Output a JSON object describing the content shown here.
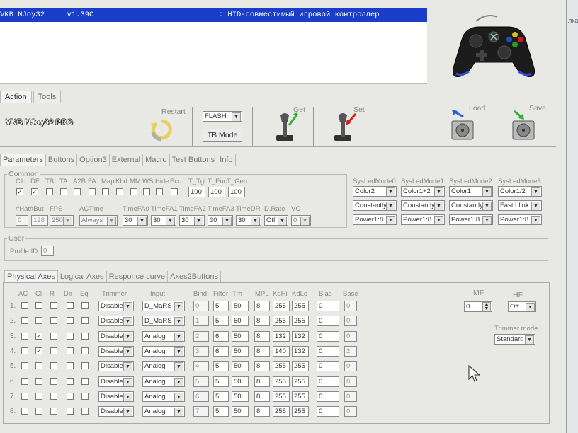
{
  "title_bar": "VKB NJoy32     v1.39C                            : HID-совместимый игровой контроллер",
  "side_strip_text": "лка",
  "top_tabs": [
    "Action",
    "Tools"
  ],
  "brand": "VKB NJoy32 PRO",
  "toolbar": {
    "restart": "Restart",
    "flash_select": "FLASH",
    "tb_mode": "TB Mode",
    "get": "Get",
    "set": "Set",
    "load": "Load",
    "save": "Save"
  },
  "param_tabs": [
    "Parameters",
    "Buttons",
    "Option3",
    "External",
    "Macro",
    "Test Buttons",
    "Info"
  ],
  "common": {
    "title": "Common",
    "checkbox_labels": [
      "Clb",
      "DF",
      "TB",
      "TA",
      "A2B",
      "FA",
      "Map",
      "Kbd",
      "MM",
      "WS",
      "Hide",
      "Eco"
    ],
    "checked": [
      true,
      true,
      false,
      false,
      false,
      false,
      false,
      false,
      false,
      false,
      false,
      false
    ],
    "t_labels": [
      "T_Tgl",
      "T_Enc",
      "T_Gen"
    ],
    "t_values": [
      "100",
      "100",
      "100"
    ],
    "row2_labels": [
      "#Hat",
      "#But",
      "FPS",
      "ACTime",
      "TimeFA0",
      "TimeFA1",
      "TimeFA2",
      "TimeFA3",
      "TimeDR",
      "D.Rate",
      "VC"
    ],
    "hat": "0",
    "but": "128",
    "fps": "250",
    "actime": "Always",
    "timefa": [
      "30",
      "30",
      "30",
      "30",
      "30"
    ],
    "drate": "Off",
    "vc": "0"
  },
  "sysled": {
    "labels": [
      "SysLedMode0",
      "SysLedMode1",
      "SysLedMode2",
      "SysLedMode3"
    ],
    "row1": [
      "Color2",
      "Color1+2",
      "Color1",
      "Color1/2"
    ],
    "row2": [
      "Constantly",
      "Constantly",
      "Constantly",
      "Fast blink"
    ],
    "row3": [
      "Power1:8",
      "Power1:8",
      "Power1:8",
      "Power1:8"
    ]
  },
  "user": {
    "title": "User",
    "profile_label": "Profile ID",
    "profile_value": "0"
  },
  "axes_tabs": [
    "Physical Axes",
    "Logical Axes",
    "Responce curve",
    "Axes2Buttons"
  ],
  "axes_headers": [
    "AC",
    "Cl",
    "R",
    "Dir",
    "Eq",
    "Trimmer",
    "Input",
    "Bind",
    "Filter",
    "Trh",
    "MPL",
    "KdHi",
    "KdLo",
    "Bias",
    "Base"
  ],
  "axes_rows": [
    {
      "n": "1.",
      "cl": false,
      "trimmer": "Disable",
      "input": "D_MaRS",
      "bind": "0",
      "filter": "5",
      "trh": "50",
      "mpl": "8",
      "kdhi": "255",
      "kdlo": "255",
      "bias": "0",
      "base": "0"
    },
    {
      "n": "2.",
      "cl": false,
      "trimmer": "Disable",
      "input": "D_MaRS",
      "bind": "1",
      "filter": "5",
      "trh": "50",
      "mpl": "8",
      "kdhi": "255",
      "kdlo": "255",
      "bias": "0",
      "base": "0"
    },
    {
      "n": "3.",
      "cl": true,
      "trimmer": "Disable",
      "input": "Analog",
      "bind": "2",
      "filter": "6",
      "trh": "50",
      "mpl": "8",
      "kdhi": "132",
      "kdlo": "132",
      "bias": "0",
      "base": "0"
    },
    {
      "n": "4.",
      "cl": true,
      "trimmer": "Disable",
      "input": "Analog",
      "bind": "3",
      "filter": "6",
      "trh": "50",
      "mpl": "8",
      "kdhi": "140",
      "kdlo": "132",
      "bias": "0",
      "base": "2"
    },
    {
      "n": "5.",
      "cl": false,
      "trimmer": "Disable",
      "input": "Analog",
      "bind": "4",
      "filter": "5",
      "trh": "50",
      "mpl": "8",
      "kdhi": "255",
      "kdlo": "255",
      "bias": "0",
      "base": "0"
    },
    {
      "n": "6.",
      "cl": false,
      "trimmer": "Disable",
      "input": "Analog",
      "bind": "5",
      "filter": "5",
      "trh": "50",
      "mpl": "8",
      "kdhi": "255",
      "kdlo": "255",
      "bias": "0",
      "base": "0"
    },
    {
      "n": "7.",
      "cl": false,
      "trimmer": "Disable",
      "input": "Analog",
      "bind": "6",
      "filter": "5",
      "trh": "50",
      "mpl": "8",
      "kdhi": "255",
      "kdlo": "255",
      "bias": "0",
      "base": "0"
    },
    {
      "n": "8.",
      "cl": false,
      "trimmer": "Disable",
      "input": "Analog",
      "bind": "7",
      "filter": "5",
      "trh": "50",
      "mpl": "8",
      "kdhi": "255",
      "kdlo": "255",
      "bias": "0",
      "base": "0"
    }
  ],
  "mf": {
    "label": "MF",
    "value": "0"
  },
  "hf": {
    "label": "HF",
    "value": "Off"
  },
  "trimmer_mode": {
    "label": "Trimmer mode",
    "value": "Standard"
  }
}
